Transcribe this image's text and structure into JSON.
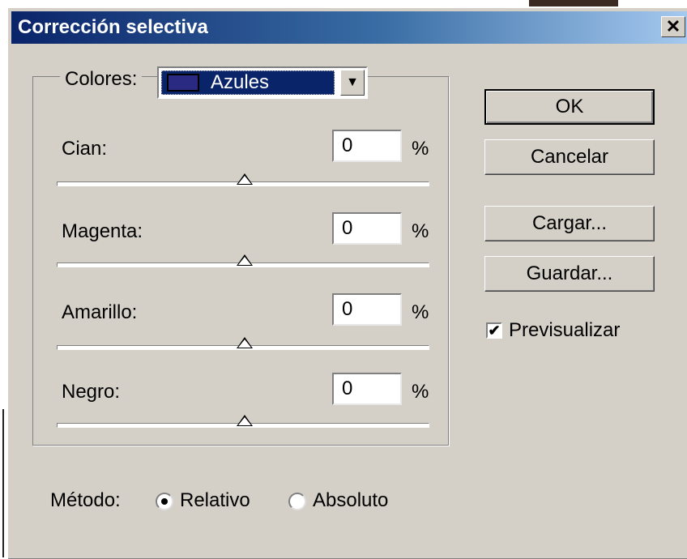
{
  "dialog": {
    "title": "Corrección selectiva",
    "close_symbol": "✕"
  },
  "colors": {
    "label": "Colores:",
    "selected": "Azules",
    "dropdown_arrow": "▼"
  },
  "sliders": [
    {
      "label": "Cian:",
      "value": "0",
      "unit": "%"
    },
    {
      "label": "Magenta:",
      "value": "0",
      "unit": "%"
    },
    {
      "label": "Amarillo:",
      "value": "0",
      "unit": "%"
    },
    {
      "label": "Negro:",
      "value": "0",
      "unit": "%"
    }
  ],
  "buttons": {
    "ok": "OK",
    "cancel": "Cancelar",
    "load": "Cargar...",
    "save": "Guardar..."
  },
  "preview": {
    "label": "Previsualizar",
    "checked": true,
    "check_symbol": "✔"
  },
  "method": {
    "label": "Método:",
    "options": [
      {
        "label": "Relativo",
        "selected": true
      },
      {
        "label": "Absoluto",
        "selected": false
      }
    ]
  },
  "theme": {
    "dialog_bg": "#d4d0c8",
    "title_start": "#0a246a",
    "title_end": "#a6caf0",
    "swatch": "#2b2a83"
  }
}
